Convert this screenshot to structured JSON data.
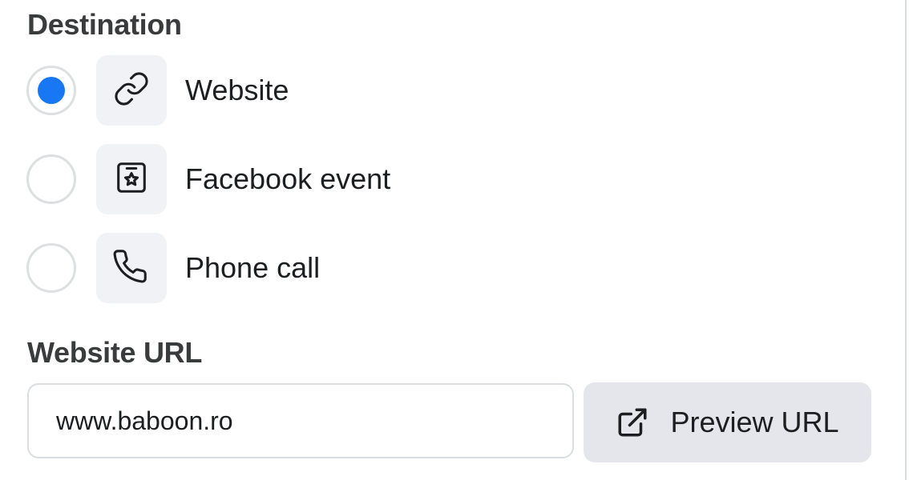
{
  "destination": {
    "title": "Destination",
    "selected": "website",
    "options": [
      {
        "id": "website",
        "label": "Website",
        "icon": "link-icon",
        "selected": true
      },
      {
        "id": "facebook-event",
        "label": "Facebook event",
        "icon": "event-star-icon",
        "selected": false
      },
      {
        "id": "phone-call",
        "label": "Phone call",
        "icon": "phone-icon",
        "selected": false
      }
    ]
  },
  "website_url": {
    "title": "Website URL",
    "value": "www.baboon.ro",
    "placeholder": "",
    "preview_button": {
      "label": "Preview URL",
      "icon": "external-link-icon"
    }
  },
  "colors": {
    "accent": "#1877f2",
    "tile_background": "#f0f2f5",
    "button_background": "#e4e6eb",
    "border": "#dadde1"
  }
}
